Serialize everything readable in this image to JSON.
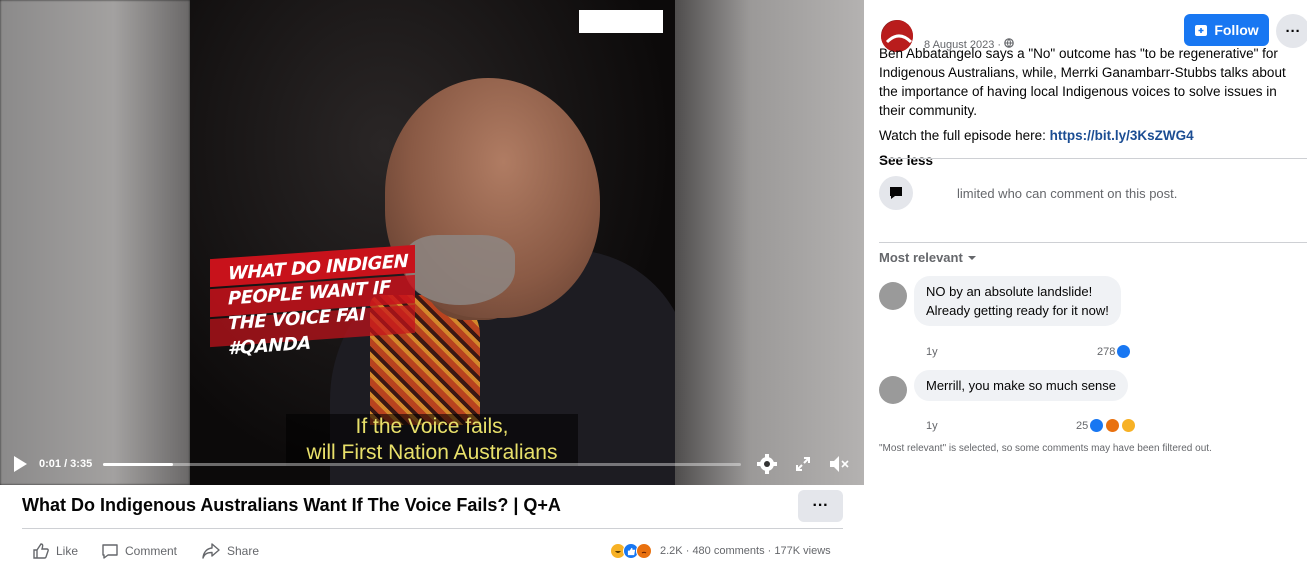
{
  "video": {
    "overlay_text": "WHAT DO INDIGEN\nPEOPLE WANT IF\nTHE VOICE FAI\n#QANDA",
    "subtitle_line1": "If the Voice fails,",
    "subtitle_line2": "will First Nation Australians",
    "time": "0:01 / 3:35",
    "progress": 0.11
  },
  "title": "What Do Indigenous Australians Want If The Voice Fails? | Q+A",
  "more_label": "···",
  "actions": {
    "like": "Like",
    "comment": "Comment",
    "share": "Share"
  },
  "stats": {
    "reactions": "2.2K",
    "comments": "480 comments",
    "views": "177K views",
    "dot": "·"
  },
  "post": {
    "date": "8 August 2023 ·",
    "follow_label": "Follow",
    "dots_label": "···",
    "text": "Ben Abbatangelo says a \"No\" outcome has \"to be regenerative\" for Indigenous Australians, while, Merrki Ganambarr-Stubbs talks about the importance of having local Indigenous voices to solve issues in their community.",
    "watch_prefix": "Watch the full episode here: ",
    "link": "https://bit.ly/3KsZWG4",
    "see_less": "See less"
  },
  "limited": "limited who can comment on this post.",
  "sort_label": "Most relevant",
  "comments": [
    {
      "text_line1": "NO by an absolute landslide!",
      "text_line2": "Already getting ready for it now!",
      "time": "1y",
      "count": "278"
    },
    {
      "text_line1": "Merrill, you make so much sense",
      "text_line2": "",
      "time": "1y",
      "count": "25"
    }
  ],
  "filter_note": "\"Most relevant\" is selected, so some comments may have been filtered out.",
  "colors": {
    "accent": "#1877f2",
    "link": "#1b4d93",
    "love": "#f33e58",
    "haha": "#f7b125",
    "angry": "#e9710f"
  }
}
